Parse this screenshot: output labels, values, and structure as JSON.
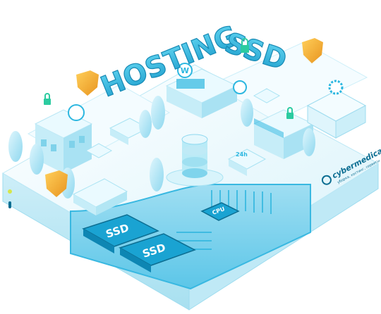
{
  "headline": {
    "word1": "HOSTING",
    "word2": "SSD"
  },
  "chips": {
    "ssd_left": "SSD",
    "ssd_right": "SSD",
    "cpu": "CPU"
  },
  "van_badge": "24h",
  "brand": {
    "name": "cybermedica",
    "tagline": "уборка, хостинг, сервисы"
  },
  "colors": {
    "base_light": "#e8f8fd",
    "base_mid": "#bfeaf6",
    "accent": "#2cc0e6",
    "dark": "#0c6e92",
    "shield": "#f5b13a",
    "shield_dark": "#e08e1c"
  },
  "icons": [
    "shield-icon",
    "lock-icon",
    "wordpress-icon",
    "joomla-icon",
    "gear-icon",
    "database-icon",
    "cloud-tree-icon",
    "truck-icon",
    "car-icon"
  ]
}
